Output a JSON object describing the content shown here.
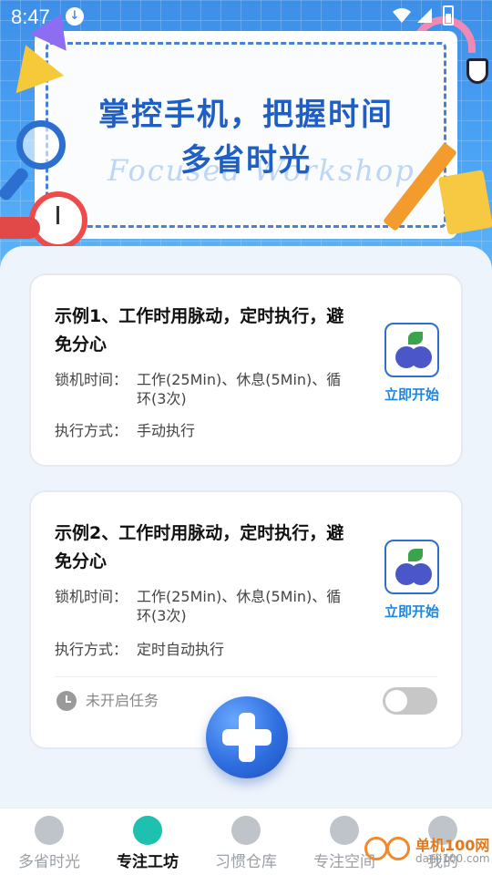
{
  "status_bar": {
    "time": "8:47"
  },
  "banner": {
    "title_line1": "掌控手机，把握时间",
    "title_line2": "多省时光",
    "script_text": "Focused   Workshop"
  },
  "cards": [
    {
      "title": "示例1、工作时用脉动，定时执行，避免分心",
      "lock_label": "锁机时间：",
      "lock_value": "工作(25Min)、休息(5Min)、循环(3次)",
      "mode_label": "执行方式：",
      "mode_value": "手动执行",
      "start_label": "立即开始"
    },
    {
      "title": "示例2、工作时用脉动，定时执行，避免分心",
      "lock_label": "锁机时间：",
      "lock_value": "工作(25Min)、休息(5Min)、循环(3次)",
      "mode_label": "执行方式：",
      "mode_value": "定时自动执行",
      "start_label": "立即开始",
      "task_status": "未开启任务",
      "toggle_on": false
    }
  ],
  "fab": {
    "icon": "plus-icon"
  },
  "bottom_nav": [
    {
      "label": "多省时光",
      "icon": "clock-icon",
      "active": false
    },
    {
      "label": "专注工坊",
      "icon": "bulb-icon",
      "active": true
    },
    {
      "label": "习惯仓库",
      "icon": "box-icon",
      "active": false
    },
    {
      "label": "专注空间",
      "icon": "layers-icon",
      "active": false
    },
    {
      "label": "我的",
      "icon": "user-icon",
      "active": false
    }
  ],
  "watermark": {
    "text": "单机100网",
    "url": "danji100.com"
  },
  "colors": {
    "accent": "#1f86e0",
    "nav_active": "#1ec1b0",
    "banner_blue": "#3d8fe8"
  }
}
